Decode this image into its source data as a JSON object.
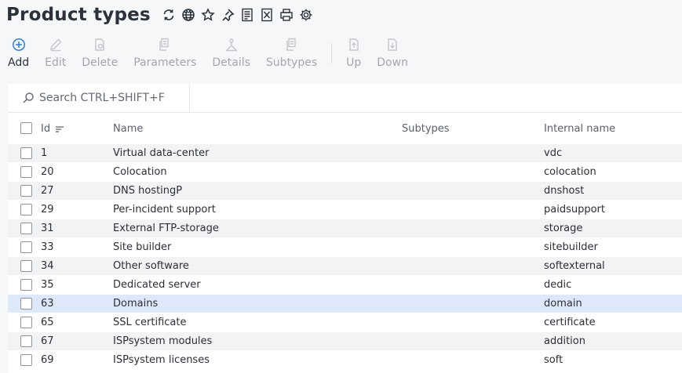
{
  "header": {
    "title": "Product types",
    "icons": [
      "refresh-icon",
      "globe-icon",
      "star-icon",
      "pin-icon",
      "pdf-export-icon",
      "excel-export-icon",
      "print-icon",
      "settings-icon"
    ]
  },
  "toolbar": {
    "buttons": [
      {
        "label": "Add",
        "icon": "plus-circle-icon",
        "enabled": true
      },
      {
        "label": "Edit",
        "icon": "pencil-icon",
        "enabled": false
      },
      {
        "label": "Delete",
        "icon": "delete-doc-icon",
        "enabled": false
      },
      {
        "label": "Parameters",
        "icon": "parameters-icon",
        "enabled": false
      },
      {
        "label": "Details",
        "icon": "details-icon",
        "enabled": false
      },
      {
        "label": "Subtypes",
        "icon": "subtypes-icon",
        "enabled": false
      },
      {
        "label": "Up",
        "icon": "up-icon",
        "enabled": false
      },
      {
        "label": "Down",
        "icon": "down-icon",
        "enabled": false
      }
    ]
  },
  "search": {
    "placeholder": "Search CTRL+SHIFT+F"
  },
  "table": {
    "columns": {
      "id": "Id",
      "name": "Name",
      "subtypes": "Subtypes",
      "internal": "Internal name"
    },
    "rows": [
      {
        "id": "1",
        "name": "Virtual data-center",
        "subtypes": "",
        "internal": "vdc"
      },
      {
        "id": "20",
        "name": "Colocation",
        "subtypes": "",
        "internal": "colocation"
      },
      {
        "id": "27",
        "name": "DNS hostingP",
        "subtypes": "",
        "internal": "dnshost"
      },
      {
        "id": "29",
        "name": "Per-incident support",
        "subtypes": "",
        "internal": "paidsupport"
      },
      {
        "id": "31",
        "name": "External FTP-storage",
        "subtypes": "",
        "internal": "storage"
      },
      {
        "id": "33",
        "name": "Site builder",
        "subtypes": "",
        "internal": "sitebuilder"
      },
      {
        "id": "34",
        "name": "Other software",
        "subtypes": "",
        "internal": "softexternal"
      },
      {
        "id": "35",
        "name": "Dedicated server",
        "subtypes": "",
        "internal": "dedic"
      },
      {
        "id": "63",
        "name": "Domains",
        "subtypes": "",
        "internal": "domain",
        "selected": true
      },
      {
        "id": "65",
        "name": "SSL certificate",
        "subtypes": "",
        "internal": "certificate"
      },
      {
        "id": "67",
        "name": "ISPsystem modules",
        "subtypes": "",
        "internal": "addition"
      },
      {
        "id": "69",
        "name": "ISPsystem licenses",
        "subtypes": "",
        "internal": "soft"
      }
    ]
  },
  "colors": {
    "accent": "#2e7cd6",
    "selected_row": "#dde9fb",
    "disabled": "#a3a7ad"
  }
}
